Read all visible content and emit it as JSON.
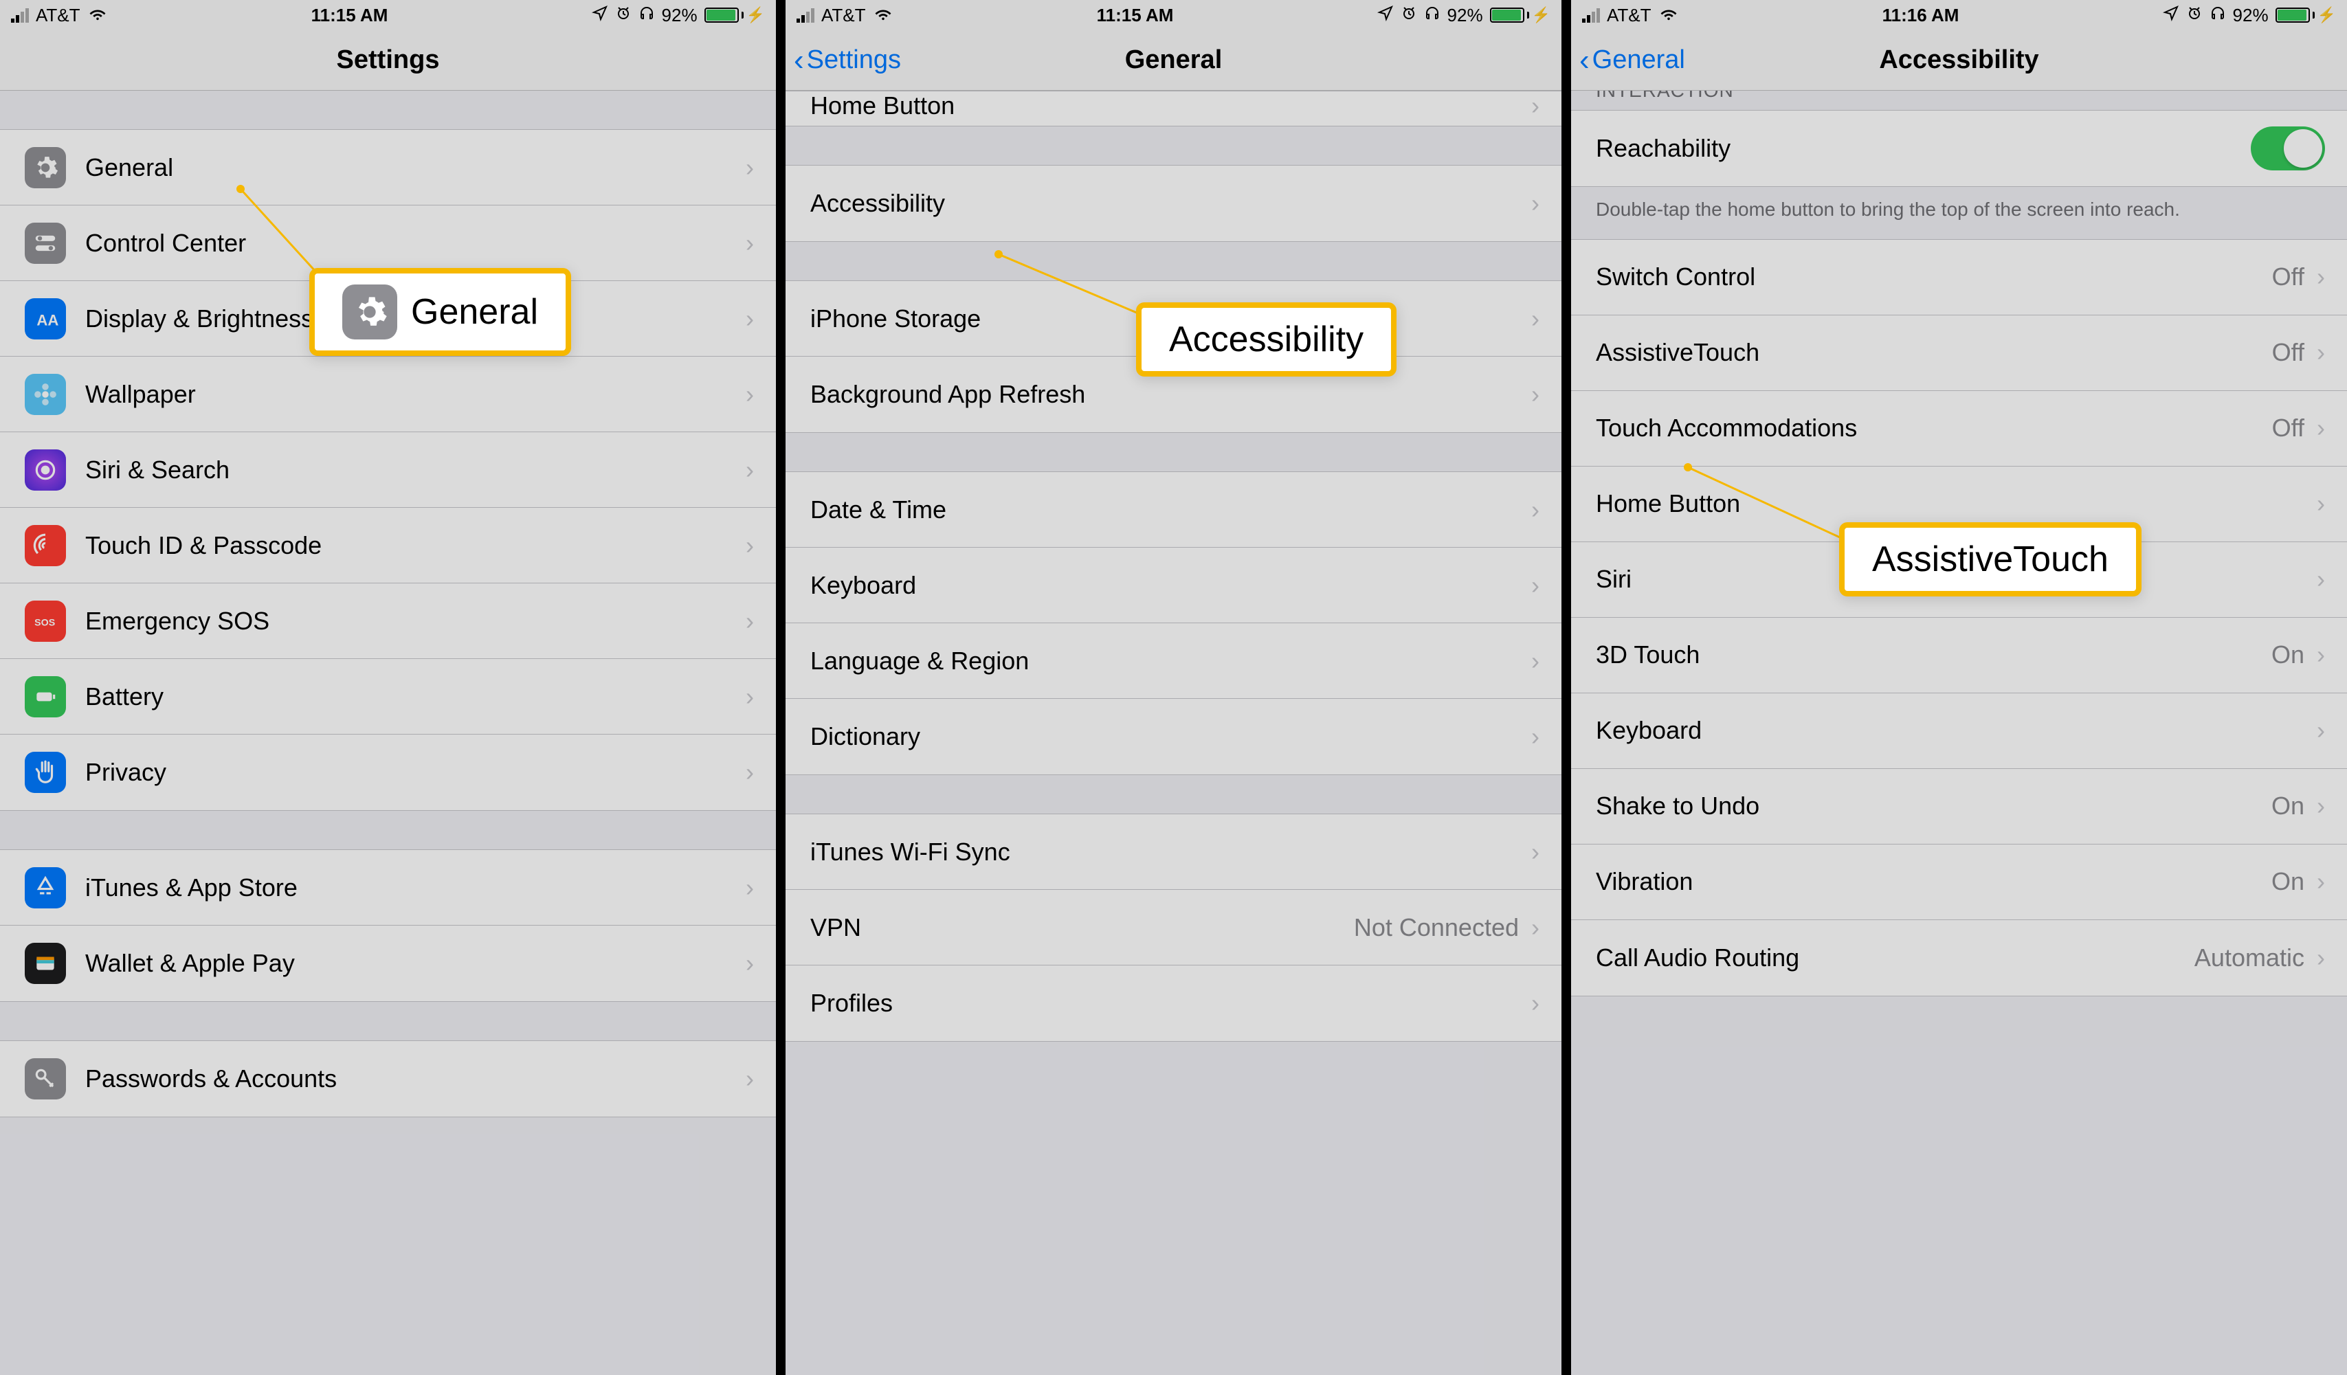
{
  "status": {
    "carrier": "AT&T",
    "time1": "11:15 AM",
    "time2": "11:15 AM",
    "time3": "11:16 AM",
    "battery_pct": "92%"
  },
  "screen1": {
    "title": "Settings",
    "callout": "General",
    "groups": [
      [
        {
          "label": "General",
          "icon": "gear",
          "bg": "bg-gray"
        },
        {
          "label": "Control Center",
          "icon": "toggles",
          "bg": "bg-gray"
        },
        {
          "label": "Display & Brightness",
          "icon": "letters",
          "bg": "bg-blue"
        },
        {
          "label": "Wallpaper",
          "icon": "flower",
          "bg": "bg-cyan"
        },
        {
          "label": "Siri & Search",
          "icon": "siri",
          "bg": "bg-purple"
        },
        {
          "label": "Touch ID & Passcode",
          "icon": "fingerprint",
          "bg": "bg-red"
        },
        {
          "label": "Emergency SOS",
          "icon": "sos",
          "bg": "bg-sos"
        },
        {
          "label": "Battery",
          "icon": "battery",
          "bg": "bg-green"
        },
        {
          "label": "Privacy",
          "icon": "hand",
          "bg": "bg-hand"
        }
      ],
      [
        {
          "label": "iTunes & App Store",
          "icon": "appstore",
          "bg": "bg-blue"
        },
        {
          "label": "Wallet & Apple Pay",
          "icon": "wallet",
          "bg": "bg-dark"
        }
      ],
      [
        {
          "label": "Passwords & Accounts",
          "icon": "key",
          "bg": "bg-key"
        }
      ]
    ]
  },
  "screen2": {
    "back": "Settings",
    "title": "General",
    "callout": "Accessibility",
    "rows": [
      {
        "label": "Home Button",
        "partial": true
      },
      {
        "gap": true
      },
      {
        "label": "Accessibility"
      },
      {
        "gap": true
      },
      {
        "label": "iPhone Storage"
      },
      {
        "label": "Background App Refresh"
      },
      {
        "gap": true
      },
      {
        "label": "Date & Time"
      },
      {
        "label": "Keyboard"
      },
      {
        "label": "Language & Region"
      },
      {
        "label": "Dictionary"
      },
      {
        "gap": true
      },
      {
        "label": "iTunes Wi-Fi Sync"
      },
      {
        "label": "VPN",
        "value": "Not Connected"
      },
      {
        "label": "Profiles"
      }
    ]
  },
  "screen3": {
    "back": "General",
    "title": "Accessibility",
    "callout": "AssistiveTouch",
    "section_header": "INTERACTION",
    "footer": "Double-tap the home button to bring the top of the screen into reach.",
    "reachability": "Reachability",
    "rows": [
      {
        "label": "Switch Control",
        "value": "Off"
      },
      {
        "label": "AssistiveTouch",
        "value": "Off"
      },
      {
        "label": "Touch Accommodations",
        "value": "Off"
      },
      {
        "label": "Home Button"
      },
      {
        "label": "Siri"
      },
      {
        "label": "3D Touch",
        "value": "On"
      },
      {
        "label": "Keyboard"
      },
      {
        "label": "Shake to Undo",
        "value": "On"
      },
      {
        "label": "Vibration",
        "value": "On"
      },
      {
        "label": "Call Audio Routing",
        "value": "Automatic"
      }
    ]
  }
}
